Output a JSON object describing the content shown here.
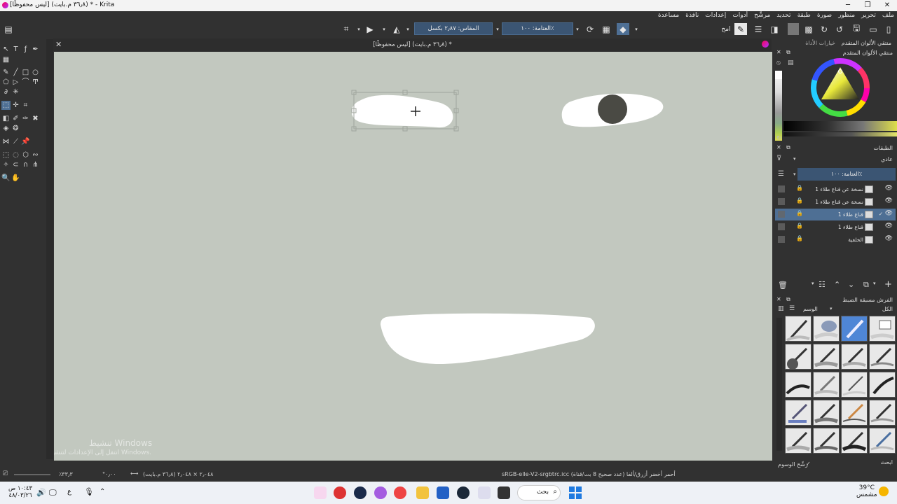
{
  "window": {
    "title": "[ليس محفوظًا]  (٣٦٫٨ م.بايت) * - Krita",
    "controls": [
      "─",
      "❐",
      "✕"
    ]
  },
  "menu": [
    "ملف",
    "تحرير",
    "منظور",
    "صورة",
    "طبقة",
    "تحديد",
    "مرشّح",
    "أدوات",
    "إعدادات",
    "نافذة",
    "مساعدة"
  ],
  "toolbar": {
    "size_field": "المقاس: ٢٫٨٧ بكسل",
    "opacity_field": "العتامة: ١٠٠٪",
    "blend_mode": "امح"
  },
  "document_tab": {
    "title": "[ليس محفوظًا] (٣٦٫٨ م.بايت) *",
    "close": "✕"
  },
  "right_panel": {
    "tab_color_selector": "منتقي الألوان المتقدم",
    "tab_tool_options": "خيارات الأداة",
    "color_selector_header": "منتقي الألوان المتقدم",
    "layers_header": "الطبقات",
    "blend_mode_label": "عادي",
    "layer_opacity": "العتامة: ١٠٠٪",
    "layers": [
      {
        "name": "نسخة عن قناع طلاء 1",
        "selected": false
      },
      {
        "name": "نسخة عن قناع طلاء 1",
        "selected": false
      },
      {
        "name": "قناع طلاء 1",
        "selected": true
      },
      {
        "name": "قناع طلاء 1",
        "selected": false
      },
      {
        "name": "الخلفية",
        "selected": false
      }
    ],
    "presets_header": "الفرش مسبقة الضبط",
    "presets_filter_all": "الكل",
    "presets_tag": "الوسم",
    "presets_search_label": "ابحث",
    "filter_tag_checkbox": "رشّح الوسوم"
  },
  "status": {
    "color_space": "sRGB-elle-V2-srgbtrc.icc  أحمر أخضر أزرق/ألفا (عدد صحيح 8 بت/قناة)",
    "dimensions": "٢٫٠٤٨ × ٢٫٠٤٨ (٣٦٫٨ م.بايت)",
    "zoom": "٪٣٣٫٣",
    "rotation": "°٠٫٠٠"
  },
  "watermark": {
    "line1": "تنشيط Windows",
    "line2": "انتقل إلى الإعدادات لتنشيط Windows."
  },
  "taskbar": {
    "time": "١٠:٤٣ ص",
    "date": "٤٨/٠٣/٢٦",
    "search_placeholder": "بحث",
    "weather_temp": "39°C",
    "weather_desc": "مشمس",
    "lang": "ع"
  },
  "colors": {
    "canvas_bg": "#c2c8bf",
    "shape_fill": "#ffffff",
    "pupil": "#4a4a44",
    "accent": "#4e6f94"
  }
}
